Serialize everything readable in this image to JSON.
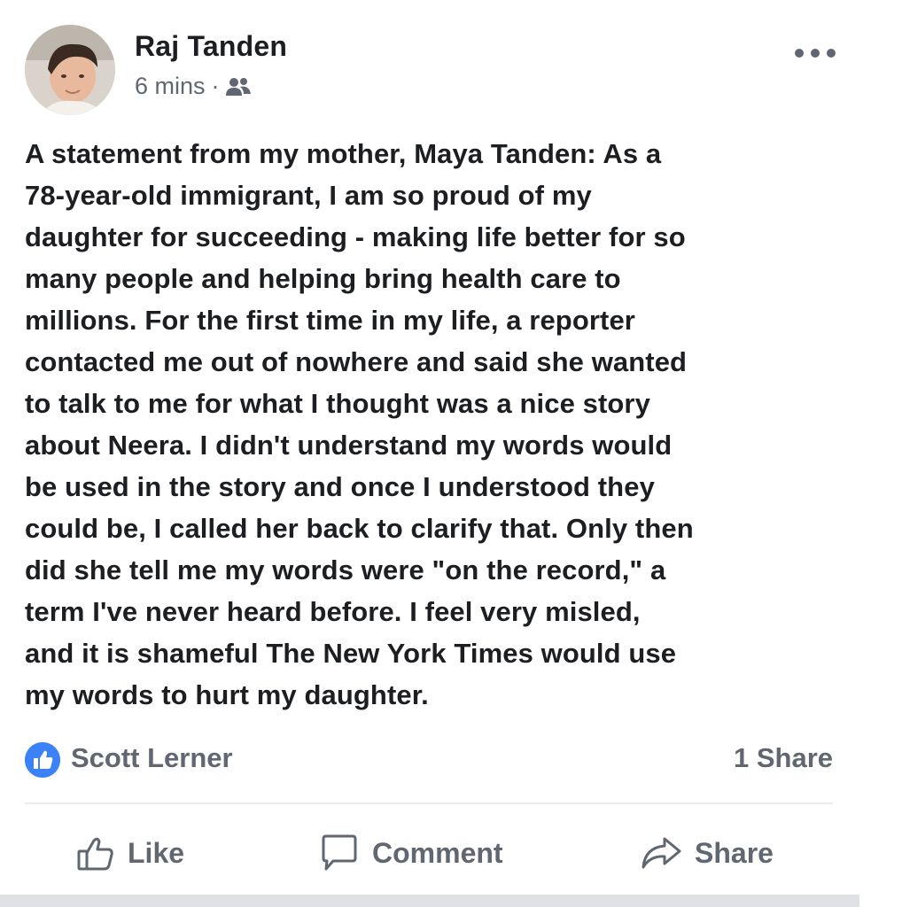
{
  "post": {
    "author": "Raj Tanden",
    "timestamp": "6 mins",
    "separator": "·",
    "audience_icon": "friends-icon",
    "more_icon": "more-options-icon",
    "text_lines": [
      "A statement from my mother, Maya Tanden: As a",
      "78-year-old immigrant, I am so proud of my",
      "daughter for succeeding - making life better for so",
      "many people and helping bring health care to",
      "millions. For the first time in my life, a reporter",
      "contacted me out of nowhere and said she wanted",
      "to talk to me for what I thought was a nice story",
      "about Neera. I didn't understand my words would",
      "be used in the story and once I understood they",
      "could be, I called her back to clarify that. Only then",
      "did she tell me my words were \"on the record,\" a",
      "term I've never heard before. I feel very misled,",
      "and it is shameful The New York Times would use",
      "my words to hurt my daughter."
    ]
  },
  "reactions": {
    "reactor": "Scott Lerner",
    "shares": "1 Share",
    "badge_color": "#3b82f6"
  },
  "actions": {
    "like": "Like",
    "comment": "Comment",
    "share": "Share"
  },
  "colors": {
    "text": "#1c1e21",
    "secondary": "#606770"
  }
}
